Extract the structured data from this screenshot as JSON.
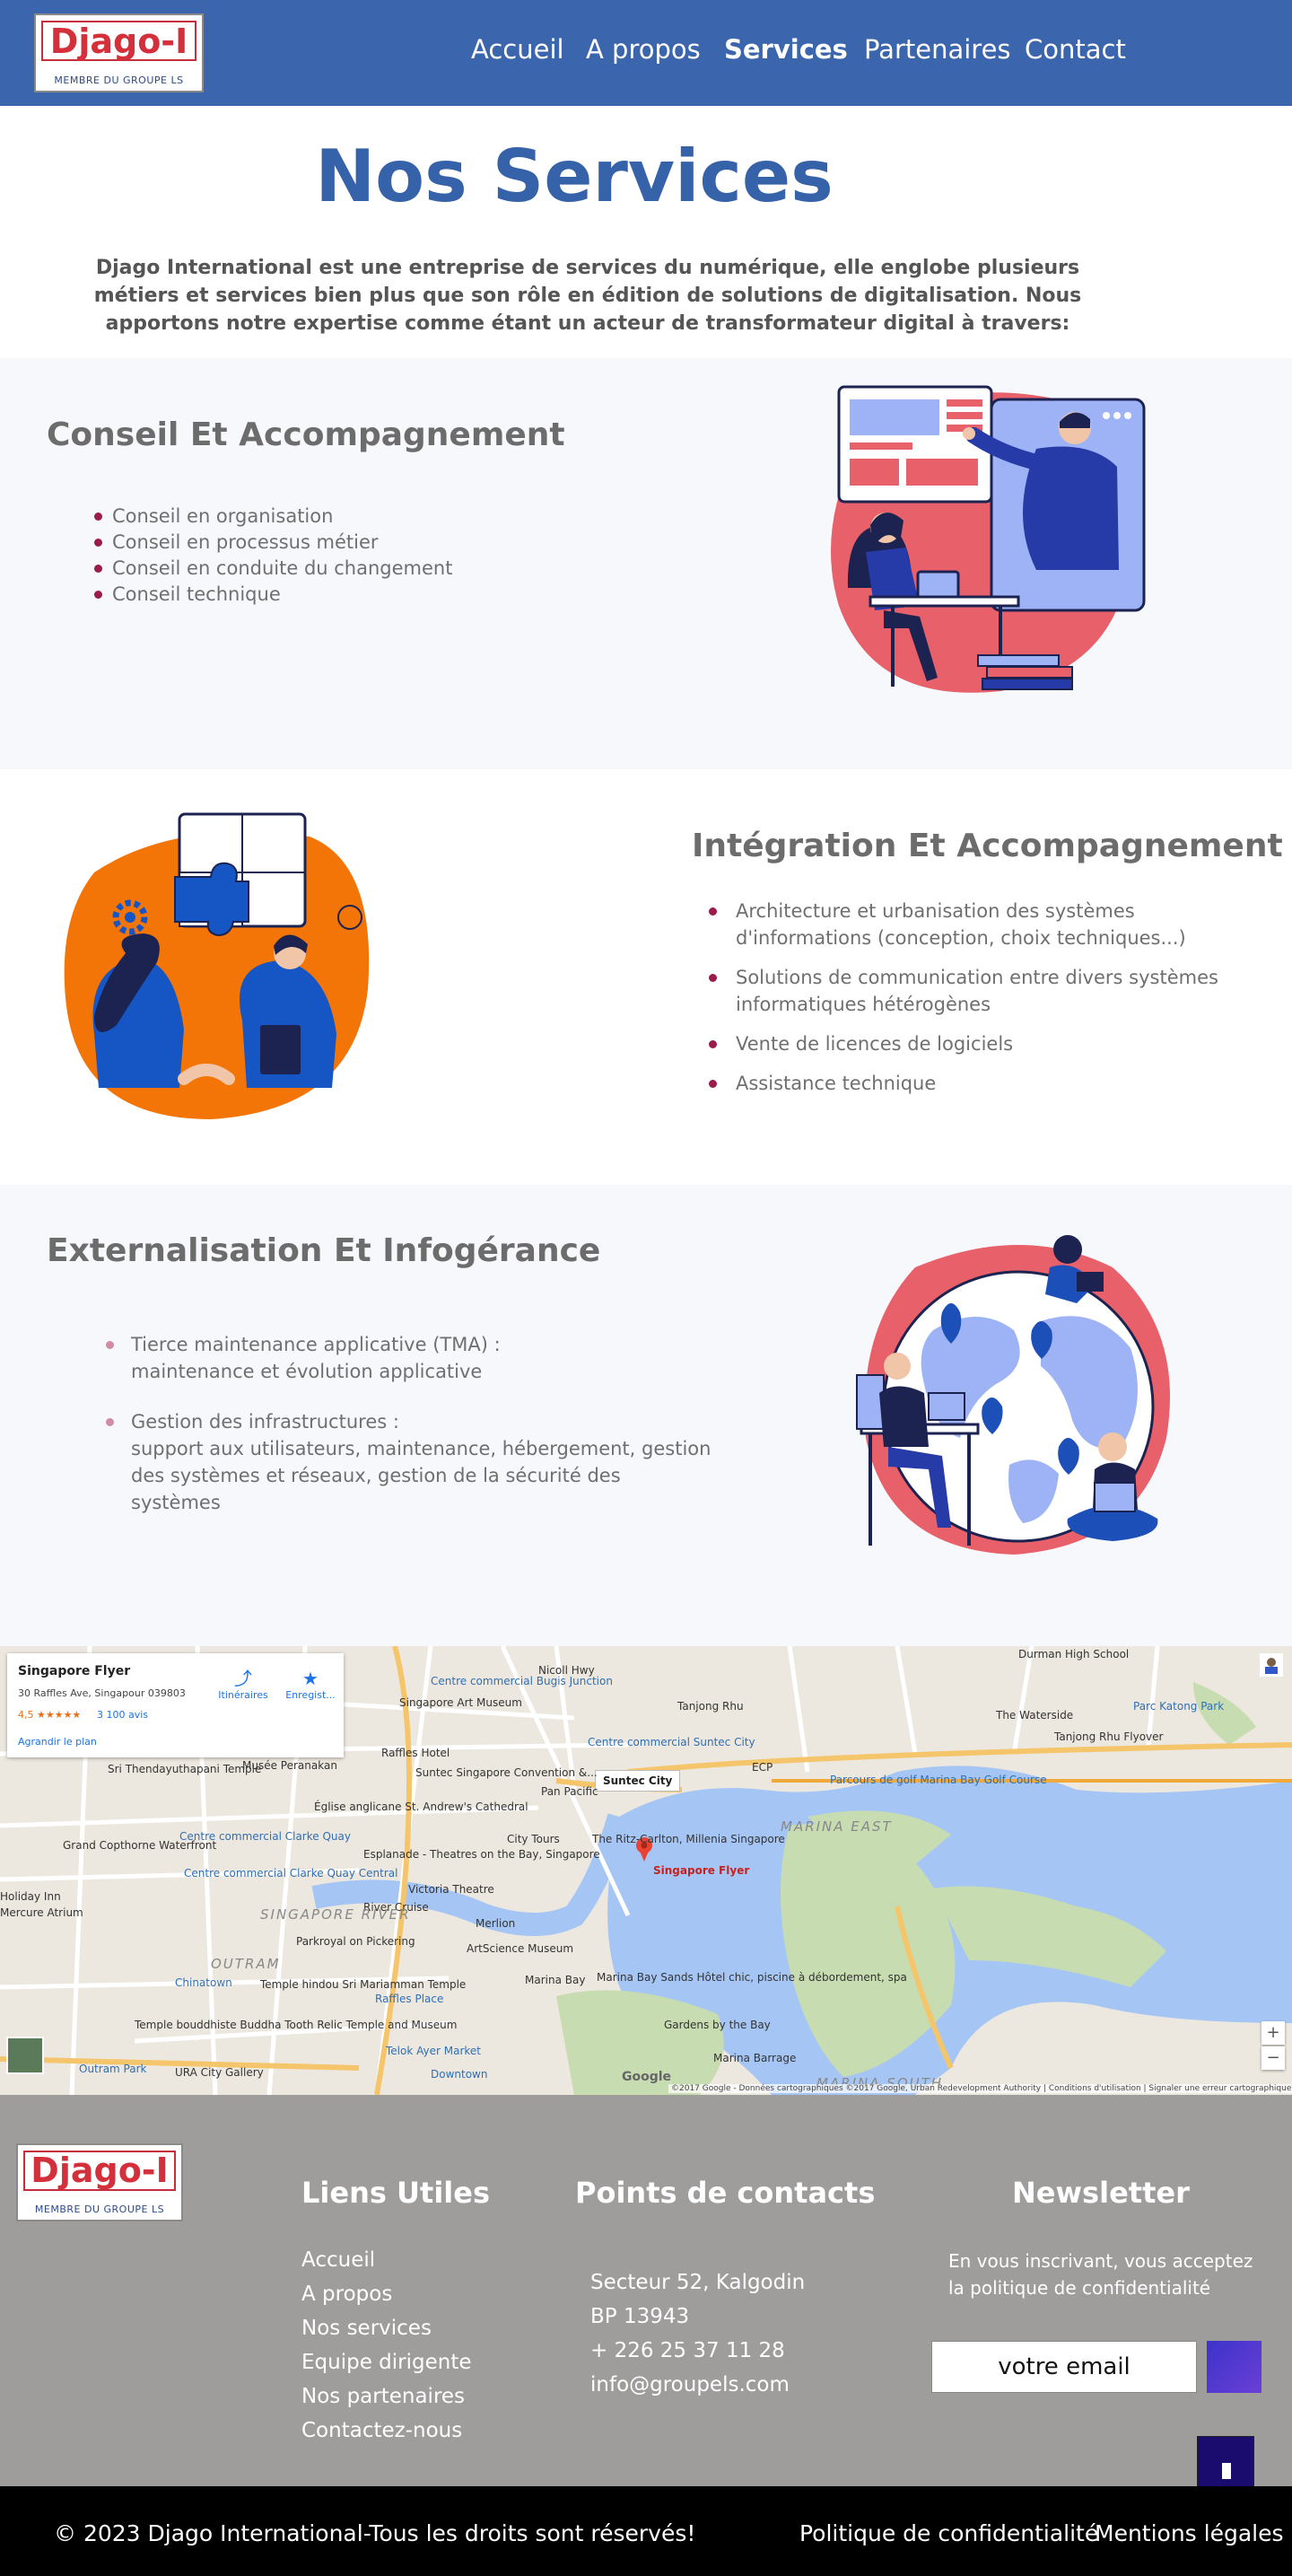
{
  "brand": {
    "logo_text": "Djago-I",
    "logo_subtext": "MEMBRE DU GROUPE LS"
  },
  "nav": {
    "items": [
      "Accueil",
      "A propos",
      "Services",
      "Partenaires",
      "Contact"
    ],
    "active": "Services"
  },
  "hero": {
    "title": "Nos Services",
    "intro": "Djago International est une entreprise de services du numérique, elle englobe plusieurs métiers et services bien plus que son rôle en édition de solutions de digitalisation. Nous apportons notre expertise comme étant un acteur de transformateur digital à travers:"
  },
  "services": [
    {
      "title": "Conseil Et Accompagnement",
      "items": [
        "Conseil en organisation",
        "Conseil en processus métier",
        "Conseil en conduite du changement",
        "Conseil technique"
      ]
    },
    {
      "title": "Intégration Et Accompagnement",
      "items": [
        "Architecture et urbanisation des systèmes d'informations (conception, choix techniques...)",
        "Solutions de communication entre divers systèmes informatiques hétérogènes",
        "Vente de licences de logiciels",
        "Assistance technique"
      ]
    },
    {
      "title": "Externalisation Et Infogérance",
      "items": [
        {
          "line1": "Tierce maintenance applicative (TMA) :",
          "line2": "maintenance et évolution applicative"
        },
        {
          "line1": "Gestion des infrastructures :",
          "line2": "support aux utilisateurs, maintenance, hébergement, gestion des systèmes et réseaux, gestion de la sécurité des systèmes"
        }
      ]
    }
  ],
  "map": {
    "place_name": "Singapore Flyer",
    "address": "30 Raffles Ave, Singapour 039803",
    "rating": "4,5 ★★★★★",
    "reviews": "3 100 avis",
    "enlarge": "Agrandir le plan",
    "directions": "Itinéraires",
    "save": "Enregist...",
    "callout": "Suntec City",
    "pin_label": "Singapore Flyer",
    "google": "Google",
    "attribution": "©2017 Google - Données cartographiques ©2017 Google, Urban Redevelopment Authority | Conditions d'utilisation | Signaler une erreur cartographique",
    "zoom_in": "+",
    "zoom_out": "−",
    "labels": [
      "Centre commercial Bugis Junction",
      "Singapore Art Museum",
      "Raffles Hotel",
      "Suntec Singapore Convention &...",
      "Centre commercial Suntec City",
      "Pan Pacific",
      "Musée Peranakan",
      "Église anglicane St. Andrew's Cathedral",
      "Grand Copthorne Waterfront",
      "Centre commercial Clarke Quay",
      "Centre commercial Clarke Quay Central",
      "Esplanade - Theatres on the Bay, Singapore",
      "Victoria Theatre",
      "City Tours",
      "The Ritz-Carlton, Millenia Singapore",
      "River Cruise",
      "Merlion",
      "Parkroyal on Pickering",
      "ArtScience Museum",
      "Marina Bay Sands Hôtel chic, piscine à débordement, spa",
      "Gardens by the Bay",
      "Marina Barrage",
      "Telok Ayer Market",
      "Temple hindou Sri Mariamman Temple",
      "Temple bouddhiste Buddha Tooth Relic Temple and Museum",
      "URA City Gallery",
      "Tanjong Rhu",
      "Parcours de golf Marina Bay Golf Course",
      "The Waterside",
      "Parc Katong Park",
      "Tanjong Rhu Flyover",
      "Durman High School",
      "Marina Bay",
      "Chinatown",
      "Raffles Place",
      "Downtown",
      "Outram Park",
      "Holiday Inn",
      "Mercure Atrium",
      "Sri Thendayuthapani Temple",
      "Nicoll Hwy",
      "ECP"
    ],
    "area_labels": [
      "MARINA EAST",
      "SINGAPORE RIVER",
      "OUTRAM",
      "MARINA SOUTH"
    ]
  },
  "footer": {
    "links_title": "Liens Utiles",
    "links": [
      "Accueil",
      "A propos",
      "Nos services",
      "Equipe dirigente",
      "Nos partenaires",
      "Contactez-nous"
    ],
    "contacts_title": "Points de contacts",
    "contacts": [
      "Secteur 52, Kalgodin",
      "BP 13943",
      "+ 226 25 37 11 28",
      "info@groupels.com"
    ],
    "newsletter_title": "Newsletter",
    "newsletter_text": "En vous inscrivant, vous acceptez la politique de confidentialité",
    "email_placeholder": "votre email",
    "copyright": "© 2023 Djago International-Tous les droits sont réservés!",
    "privacy": "Politique de confidentialité",
    "legal": "Mentions légales"
  },
  "colors": {
    "header": "#3b65ad",
    "title": "#3562a8",
    "bullet": "#9b1b4b",
    "footer": "#9f9c9c",
    "bottom_bar": "#000000",
    "submit": "#4b37cf",
    "scroll_top": "#190c6e"
  }
}
